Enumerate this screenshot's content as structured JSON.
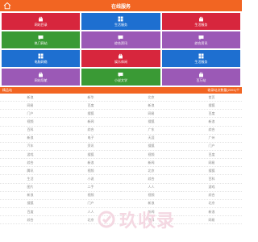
{
  "header": {
    "title": "在线服务"
  },
  "tiles": [
    {
      "label": "网站目录",
      "color": "#d7263d",
      "icon": "bag-icon"
    },
    {
      "label": "生活服务",
      "color": "#1e6fd0",
      "icon": "windows-icon"
    },
    {
      "label": "生活服务",
      "color": "#d7263d",
      "icon": "bag-icon"
    },
    {
      "label": "热门网站",
      "color": "#3a9a35",
      "icon": "chat-icon"
    },
    {
      "label": "综合资讯",
      "color": "#9b59b6",
      "icon": "chat-icon"
    },
    {
      "label": "综合资讯",
      "color": "#9b59b6",
      "icon": "chat-icon"
    },
    {
      "label": "电脑网络",
      "color": "#1e6fd0",
      "icon": "windows-icon"
    },
    {
      "label": "娱乐休闲",
      "color": "#d7263d",
      "icon": "bag-icon"
    },
    {
      "label": "生活服务",
      "color": "#1e6fd0",
      "icon": "windows-icon"
    },
    {
      "label": "网站导航",
      "color": "#9b59b6",
      "icon": "bag-icon"
    },
    {
      "label": "小说文学",
      "color": "#3a9a35",
      "icon": "chat-icon"
    },
    {
      "label": "百万站",
      "color": "#9b59b6",
      "icon": "bag-icon"
    }
  ],
  "section": {
    "left": "精品站",
    "right": "收录站点数量(2391)个"
  },
  "sites": [
    "新浪",
    "新华",
    "北京",
    "首页",
    "网易",
    "百度",
    "新浪",
    "搜狐",
    "门户",
    "搜狐",
    "网易",
    "百度",
    "视频",
    "新闻",
    "搜狐",
    "新浪",
    "百科",
    "综合",
    "广东",
    "综合",
    "新浪",
    "电子",
    "天涯",
    "广州",
    "汽车",
    "资讯",
    "搜狐",
    "门户",
    "游戏",
    "搜狐",
    "视频",
    "百度",
    "综合",
    "新浪",
    "新闻",
    "网易",
    "腾讯",
    "视频",
    "北京",
    "搜狐",
    "生活",
    "小说",
    "综合",
    "百科",
    "图片",
    "二手",
    "人人",
    "游戏",
    "新浪",
    "视频",
    "视频",
    "综合",
    "搜狐",
    "门户",
    "新浪",
    "北京",
    "百度",
    "人人",
    "新闻",
    "新浪",
    "综合",
    "北京",
    "百科",
    "网易"
  ],
  "watermark": "玖收录",
  "colors": {
    "accent": "#f26522"
  }
}
